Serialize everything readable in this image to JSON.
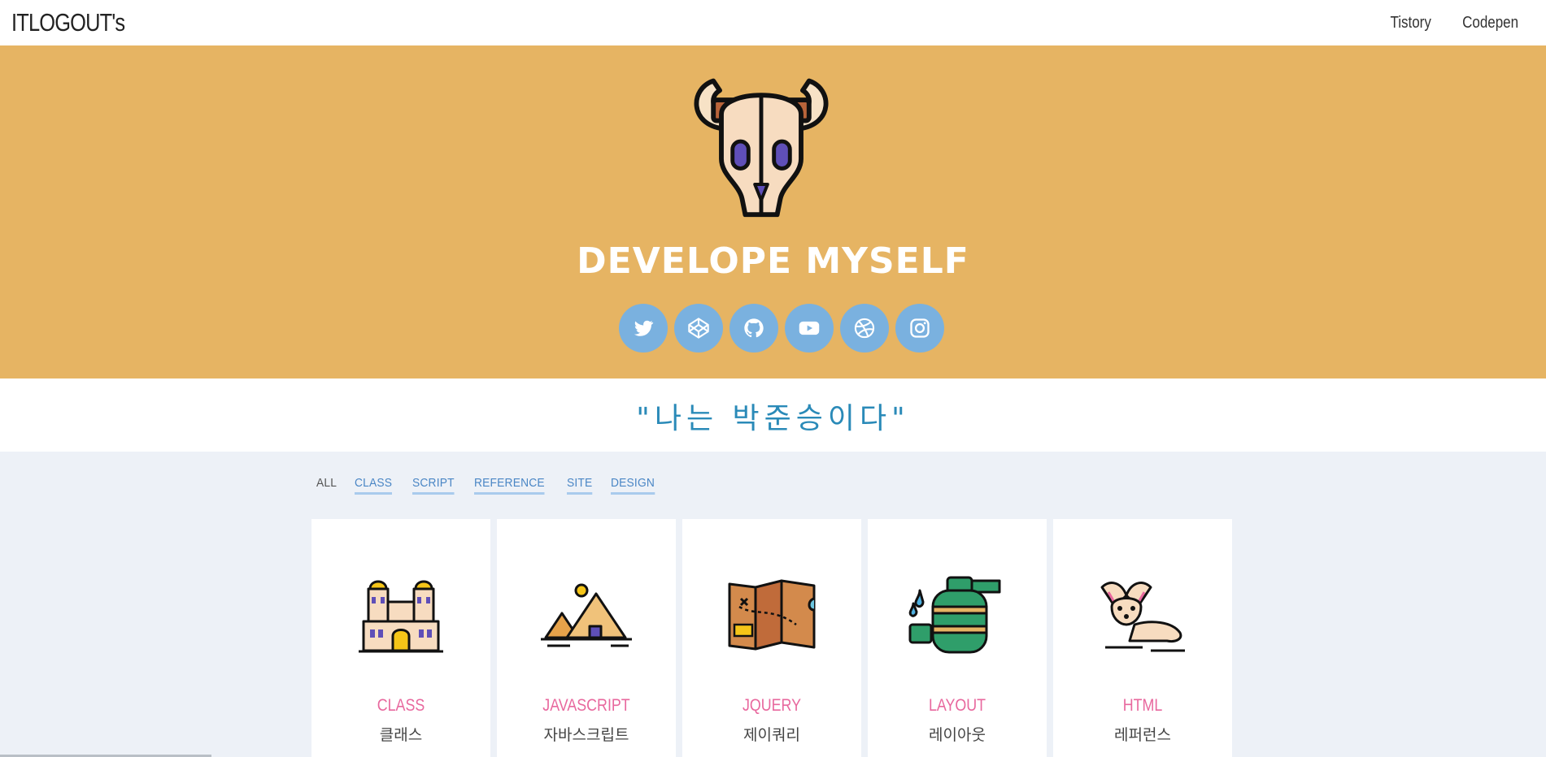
{
  "nav": {
    "brand": "ITLOGOUT's",
    "links": [
      "Tistory",
      "Codepen"
    ]
  },
  "hero": {
    "logo_icon": "bull-skull-icon",
    "title": "DEVELOPE MYSELF",
    "socials": [
      "twitter-icon",
      "codepen-icon",
      "github-icon",
      "youtube-icon",
      "dribbble-icon",
      "instagram-icon"
    ]
  },
  "quote": "\"나는 박준승이다\"",
  "filters": [
    "ALL",
    "CLASS",
    "SCRIPT",
    "REFERENCE",
    "SITE",
    "DESIGN"
  ],
  "cards": [
    {
      "title": "CLASS",
      "sub": "클래스",
      "icon": "palace-icon"
    },
    {
      "title": "JAVASCRIPT",
      "sub": "자바스크립트",
      "icon": "pyramid-icon"
    },
    {
      "title": "JQUERY",
      "sub": "제이쿼리",
      "icon": "treasure-map-icon"
    },
    {
      "title": "LAYOUT",
      "sub": "레이아웃",
      "icon": "canteen-icon"
    },
    {
      "title": "HTML",
      "sub": "레퍼런스",
      "icon": "fennec-fox-icon"
    }
  ],
  "colors": {
    "hero_bg": "#e6b463",
    "social_bg": "#7ab1df",
    "quote": "#2a8ab8",
    "card_title": "#e8689e",
    "content_bg": "#edf1f7"
  }
}
